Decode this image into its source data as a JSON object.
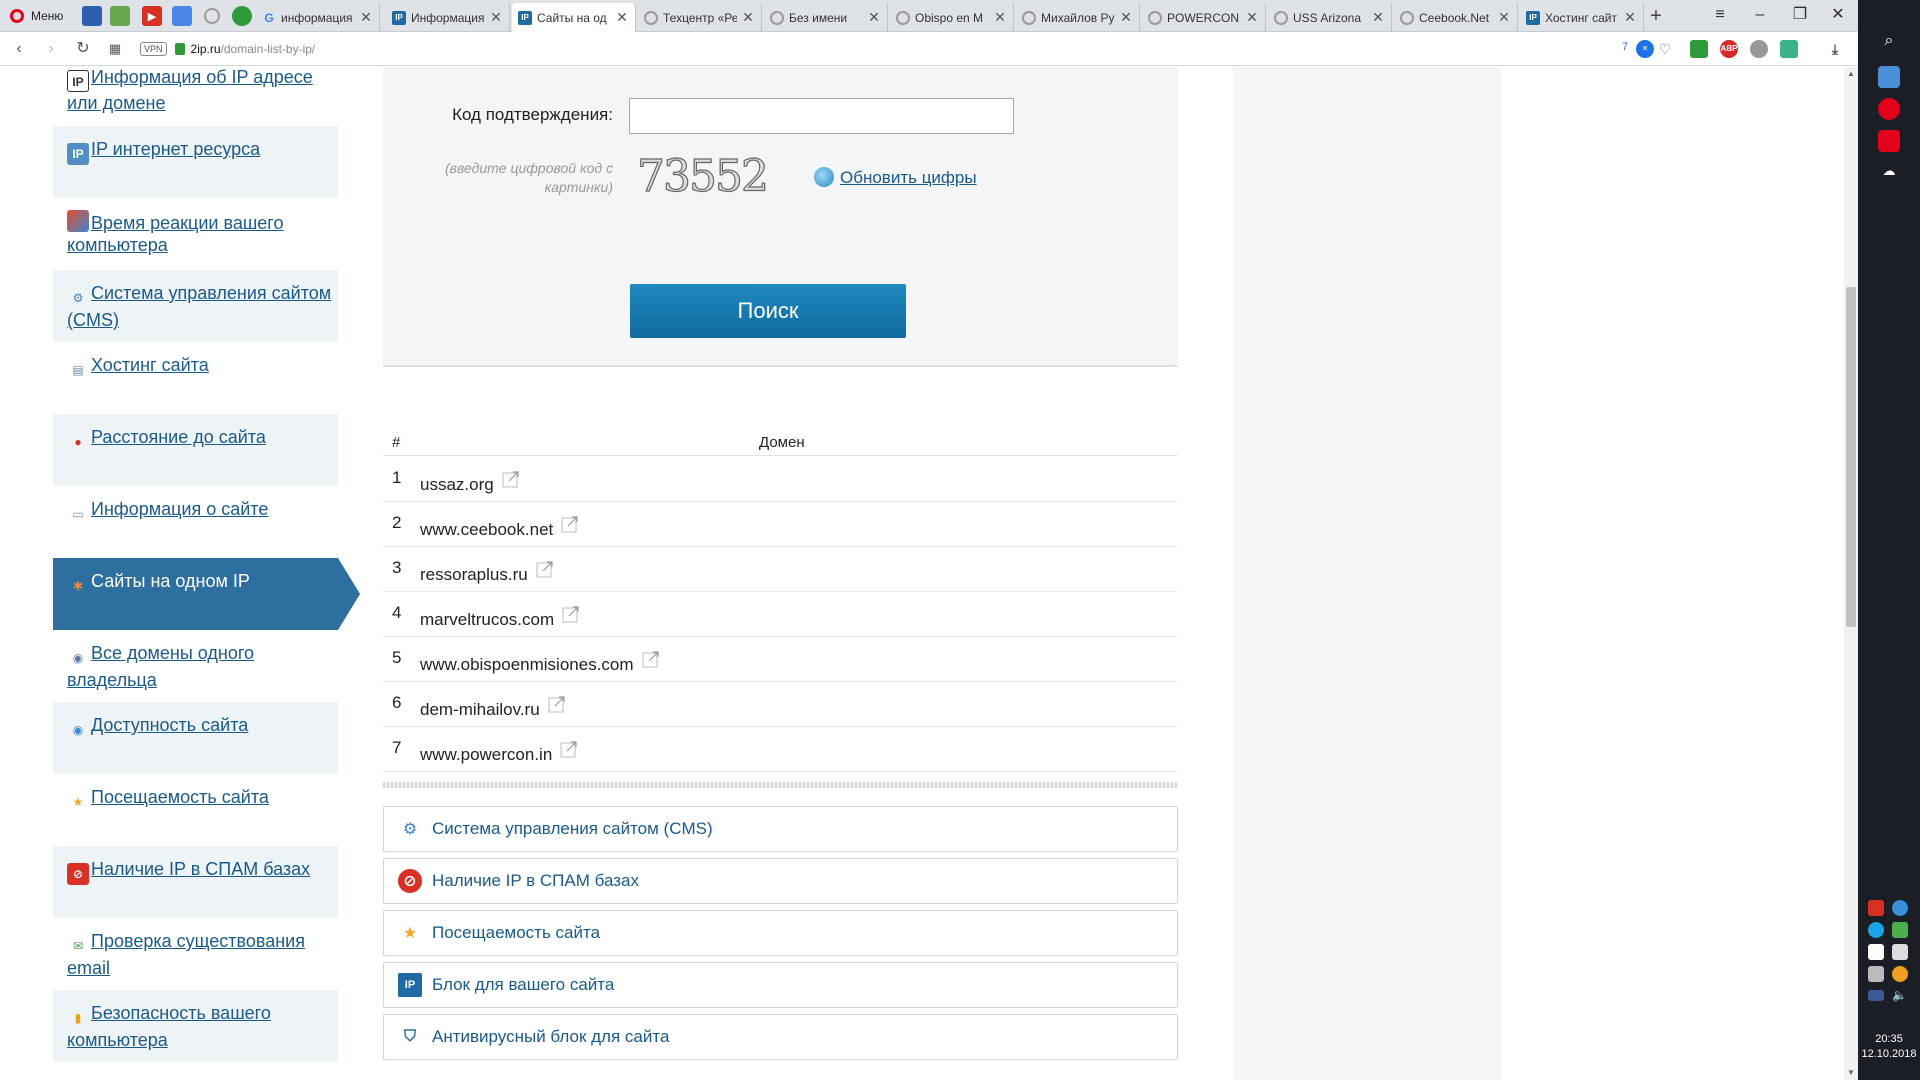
{
  "browser": {
    "menu_label": "Меню",
    "tabs": [
      {
        "title": "информация",
        "icon": "google-icon"
      },
      {
        "title": "Информация",
        "icon": "2ip-icon"
      },
      {
        "title": "Сайты на од",
        "icon": "2ip-icon",
        "active": true
      },
      {
        "title": "Техцентр «Ре",
        "icon": "loading-icon"
      },
      {
        "title": "Без имени",
        "icon": "loading-icon"
      },
      {
        "title": "Obispo en M",
        "icon": "loading-icon"
      },
      {
        "title": "Михайлов Ру",
        "icon": "loading-icon"
      },
      {
        "title": "POWERCON",
        "icon": "loading-icon"
      },
      {
        "title": "USS Arizona",
        "icon": "loading-icon"
      },
      {
        "title": "Ceebook.Net",
        "icon": "loading-icon"
      },
      {
        "title": "Хостинг сайт",
        "icon": "2ip-icon"
      }
    ],
    "url_host": "2ip.ru",
    "url_path": "/domain-list-by-ip/",
    "vpn_label": "VPN",
    "badge_count": "7",
    "clock_time": "20:35",
    "clock_date": "12.10.2018"
  },
  "nav": {
    "items": [
      {
        "label": "Информация об IP адресе или домене",
        "icon": "ip-icon"
      },
      {
        "label": "IP интернет ресурса",
        "icon": "ip-globe-icon"
      },
      {
        "label": "Время реакции вашего компьютера",
        "icon": "ping-icon"
      },
      {
        "label": "Система управления сайтом (CMS)",
        "icon": "gears-icon"
      },
      {
        "label": "Хостинг сайта",
        "icon": "server-icon"
      },
      {
        "label": "Расстояние до сайта",
        "icon": "map-pin-icon"
      },
      {
        "label": "Информация о сайте",
        "icon": "document-icon"
      },
      {
        "label": "Сайты на одном IP",
        "icon": "network-icon",
        "active": true
      },
      {
        "label": "Все домены одного владельца",
        "icon": "globe-icon"
      },
      {
        "label": "Доступность сайта",
        "icon": "globe-check-icon"
      },
      {
        "label": "Посещаемость сайта",
        "icon": "star-icon"
      },
      {
        "label": "Наличие IP в СПАМ базах",
        "icon": "spam-icon"
      },
      {
        "label": "Проверка существования email",
        "icon": "email-icon"
      },
      {
        "label": "Безопасность вашего компьютера",
        "icon": "lock-icon"
      }
    ]
  },
  "form": {
    "code_label": "Код подтверждения:",
    "code_value": "",
    "hint": "(введите цифровой код с картинки)",
    "captcha_text": "73552",
    "refresh_label": "Обновить цифры",
    "search_label": "Поиск"
  },
  "table": {
    "col_num": "#",
    "col_domain": "Домен",
    "rows": [
      {
        "n": "1",
        "domain": "ussaz.org"
      },
      {
        "n": "2",
        "domain": "www.ceebook.net"
      },
      {
        "n": "3",
        "domain": "ressoraplus.ru"
      },
      {
        "n": "4",
        "domain": "marveltrucos.com"
      },
      {
        "n": "5",
        "domain": "www.obispoenmisiones.com"
      },
      {
        "n": "6",
        "domain": "dem-mihailov.ru"
      },
      {
        "n": "7",
        "domain": "www.powercon.in"
      }
    ]
  },
  "tools": [
    {
      "label": "Система управления сайтом (CMS)",
      "icon": "gears-icon"
    },
    {
      "label": "Наличие IP в СПАМ базах",
      "icon": "spam-icon"
    },
    {
      "label": "Посещаемость сайта",
      "icon": "star-icon"
    },
    {
      "label": "Блок для вашего сайта",
      "icon": "ip-block-icon"
    },
    {
      "label": "Антивирусный блок для сайта",
      "icon": "shield-icon"
    }
  ],
  "colors": {
    "nav_active": "#2d6f9f",
    "link": "#1a5a8a",
    "button": "#0f6a9c",
    "panel_bg": "#f3f5f7"
  }
}
